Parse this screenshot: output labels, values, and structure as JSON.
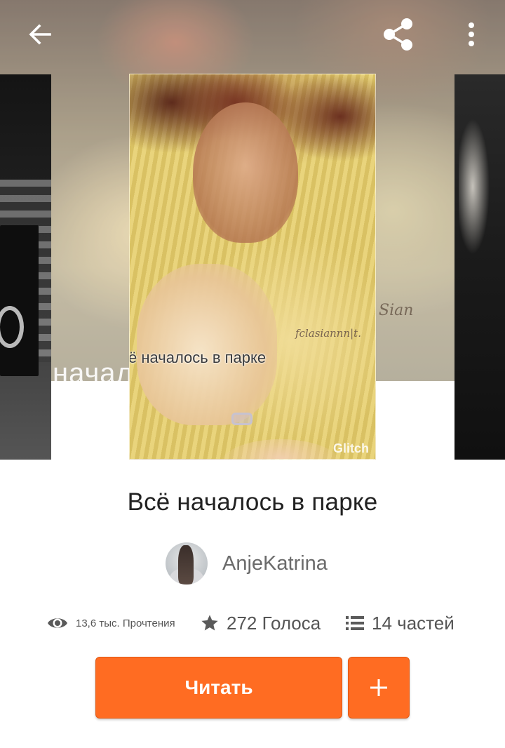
{
  "story": {
    "title": "Всё началось в парке",
    "cover_title_text": "ё началось в парке",
    "cover_signature": "fclasiannn|t.",
    "cover_watermark": "Glitch",
    "background_ghost_text": "начал",
    "background_ghost_signature": "Sian"
  },
  "author": {
    "name": "AnjeKatrina"
  },
  "stats": {
    "reads": "13,6 тыс. Прочтения",
    "votes": "272 Голоса",
    "parts": "14 частей"
  },
  "actions": {
    "read_label": "Читать",
    "add_label": "+"
  },
  "icons": {
    "back": "arrow-left-icon",
    "share": "share-icon",
    "more": "more-vertical-icon",
    "reads": "eye-icon",
    "votes": "star-icon",
    "parts": "list-icon",
    "add": "plus-icon"
  },
  "colors": {
    "accent": "#ff6c22",
    "title_text": "#222222",
    "muted_text": "#555555"
  }
}
